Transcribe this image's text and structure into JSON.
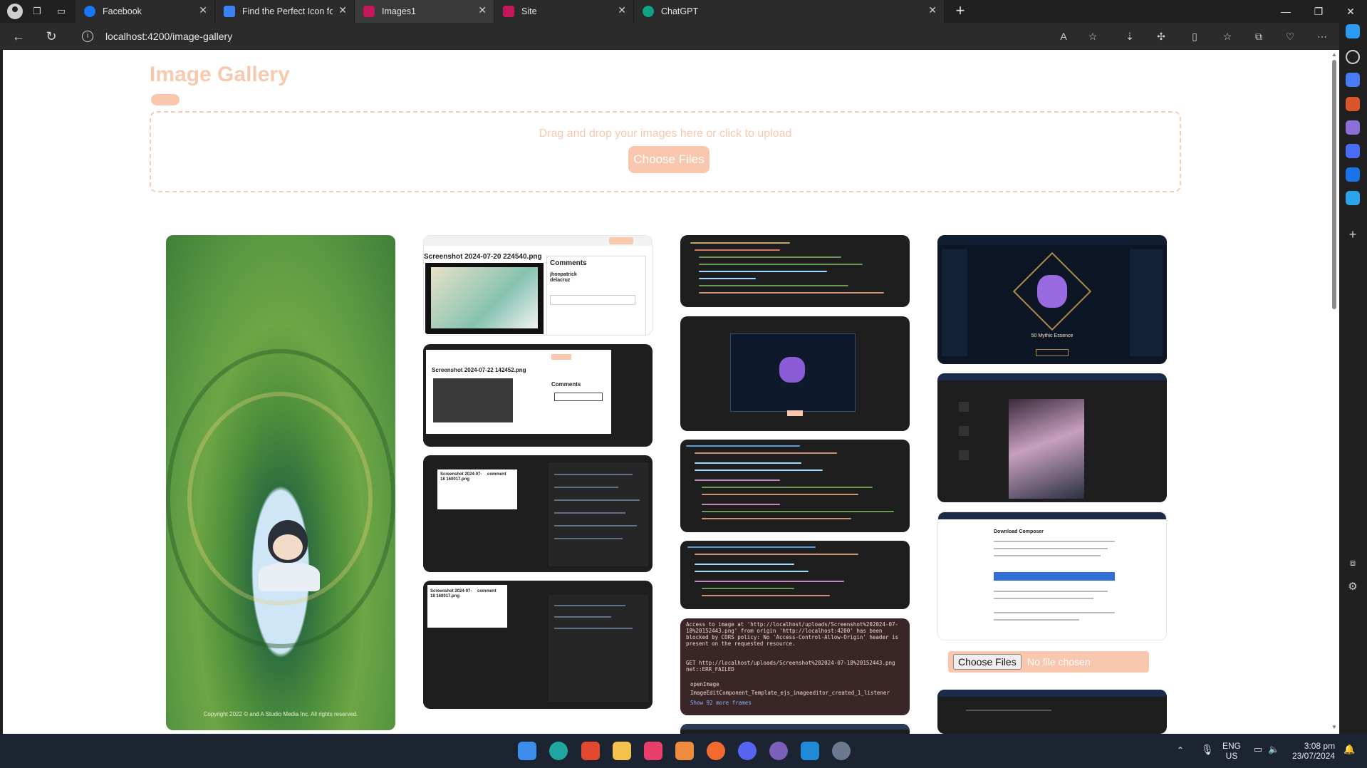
{
  "browser": {
    "tabs": [
      {
        "label": "Facebook",
        "icon": "facebook-icon",
        "color": "#1877f2"
      },
      {
        "label": "Find the Perfect Icon for Your Pro",
        "icon": "flag-icon",
        "color": "#3b82f6"
      },
      {
        "label": "Images1",
        "icon": "angular-icon",
        "color": "#c2185b"
      },
      {
        "label": "Site",
        "icon": "angular-icon",
        "color": "#c2185b"
      },
      {
        "label": "ChatGPT",
        "icon": "chatgpt-icon",
        "color": "#10a37f"
      }
    ],
    "address": "localhost:4200/image-gallery"
  },
  "page": {
    "title": "Image Gallery",
    "dropzone_hint": "Drag and drop your images here or click to upload",
    "choose_files": "Choose Files",
    "file_input_button": "Choose Files",
    "file_input_status": "No file chosen",
    "art_copyright": "Copyright 2022 © and A Studio Media Inc. All rights reserved.",
    "accent_color": "#f9c7ad"
  },
  "gallery": {
    "thumb_texts": {
      "shot1_title": "Screenshot 2024-07-20 224540.png",
      "shot1_comments": "Comments",
      "shot1_user": "jhonpatrick delacruz",
      "shot2_title": "Screenshot 2024-07-22 142452.png",
      "shot2_comments": "Comments",
      "shot3_title": "Screenshot 2024-07-18 160017.png",
      "shot3_label": "comment",
      "shot4_title": "Screenshot 2024-07-18 160017.png",
      "shot4_label": "comment",
      "essence": "50 Mythic Essence",
      "cors_text": "Access to image at 'http://localhost/uploads/Screenshot%202024-07-18%20152443.png' from origin 'http://localhost:4200' has been blocked by CORS policy: No 'Access-Control-Allow-Origin' header is present on the requested resource.",
      "cors_get": "GET http://localhost/uploads/Screenshot%202024-07-18%20152443.png net::ERR_FAILED",
      "cors_open": "openImage",
      "cors_listener": "ImageEditComponent_Template_ejs_imageeditor_created_1_listener",
      "cors_more": "Show 92 more frames",
      "doc_title": "Download Composer"
    }
  },
  "taskbar": {
    "lang": "ENG",
    "region": "US",
    "time": "3:08 pm",
    "date": "23/07/2024"
  }
}
